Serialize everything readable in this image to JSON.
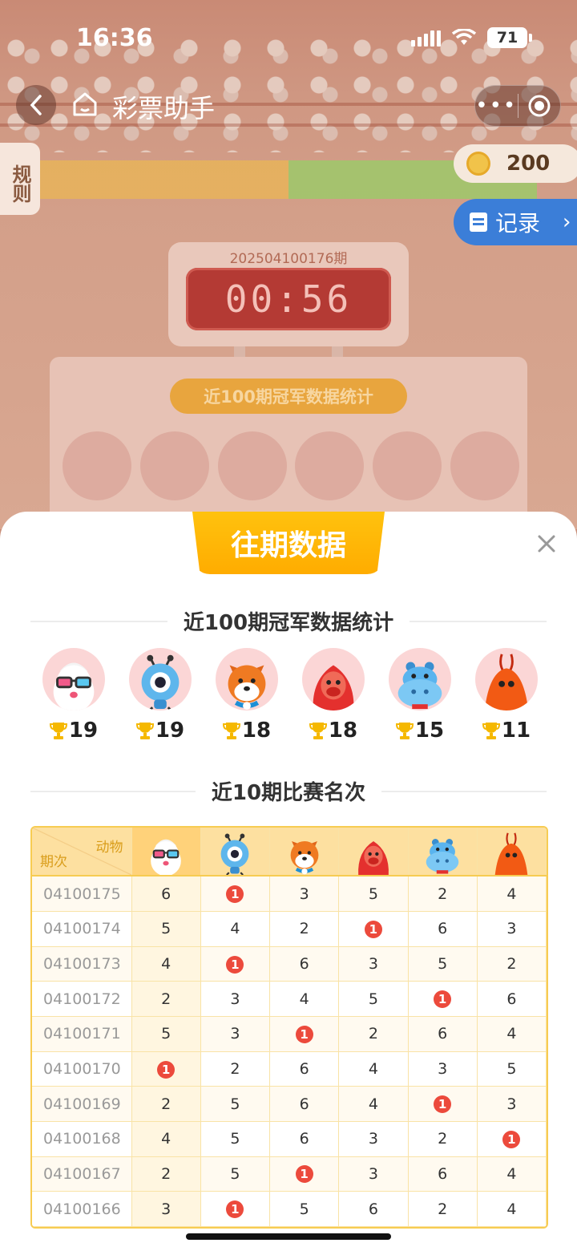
{
  "status_bar": {
    "time": "16:36",
    "battery": "71"
  },
  "nav": {
    "title": "彩票助手"
  },
  "game": {
    "rules_label": "规则",
    "coins": "200",
    "record_label": "记录",
    "period_number": "202504100176期",
    "countdown": "00:56",
    "bg_panel_title": "近100期冠军数据统计"
  },
  "sheet": {
    "title": "往期数据",
    "champions_heading": "近100期冠军数据统计",
    "ranking_heading": "近10期比赛名次",
    "champions": [
      {
        "animal": "snowman",
        "count": "19"
      },
      {
        "animal": "ant",
        "count": "19"
      },
      {
        "animal": "shiba-dog",
        "count": "18"
      },
      {
        "animal": "gorilla",
        "count": "18"
      },
      {
        "animal": "hippo",
        "count": "15"
      },
      {
        "animal": "crayfish",
        "count": "11"
      }
    ],
    "table": {
      "corner_top": "动物",
      "corner_bottom": "期次",
      "columns": [
        "snowman",
        "ant",
        "shiba-dog",
        "gorilla",
        "hippo",
        "crayfish"
      ],
      "rows": [
        {
          "period": "04100175",
          "ranks": [
            "6",
            "1",
            "3",
            "5",
            "2",
            "4"
          ]
        },
        {
          "period": "04100174",
          "ranks": [
            "5",
            "4",
            "2",
            "1",
            "6",
            "3"
          ]
        },
        {
          "period": "04100173",
          "ranks": [
            "4",
            "1",
            "6",
            "3",
            "5",
            "2"
          ]
        },
        {
          "period": "04100172",
          "ranks": [
            "2",
            "3",
            "4",
            "5",
            "1",
            "6"
          ]
        },
        {
          "period": "04100171",
          "ranks": [
            "5",
            "3",
            "1",
            "2",
            "6",
            "4"
          ]
        },
        {
          "period": "04100170",
          "ranks": [
            "1",
            "2",
            "6",
            "4",
            "3",
            "5"
          ]
        },
        {
          "period": "04100169",
          "ranks": [
            "2",
            "5",
            "6",
            "4",
            "1",
            "3"
          ]
        },
        {
          "period": "04100168",
          "ranks": [
            "4",
            "5",
            "6",
            "3",
            "2",
            "1"
          ]
        },
        {
          "period": "04100167",
          "ranks": [
            "2",
            "5",
            "1",
            "3",
            "6",
            "4"
          ]
        },
        {
          "period": "04100166",
          "ranks": [
            "3",
            "1",
            "5",
            "6",
            "2",
            "4"
          ]
        }
      ]
    }
  },
  "colors": {
    "accent": "#ffb400",
    "first_place": "#ec4a3c",
    "table_border": "#f7cc52"
  }
}
